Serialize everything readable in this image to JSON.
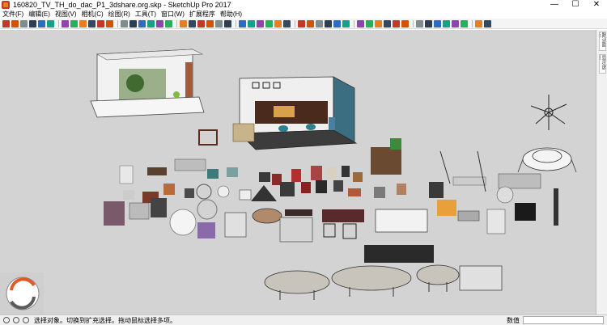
{
  "window": {
    "title": "160820_TV_TH_do_dac_P1_3dshare.org.skp - SketchUp Pro 2017",
    "minimize": "—",
    "maximize": "☐",
    "close": "✕"
  },
  "menubar": {
    "items": [
      {
        "label": "文件(F)"
      },
      {
        "label": "编辑(E)"
      },
      {
        "label": "视图(V)"
      },
      {
        "label": "相机(C)"
      },
      {
        "label": "绘图(R)"
      },
      {
        "label": "工具(T)"
      },
      {
        "label": "窗口(W)"
      },
      {
        "label": "扩展程序"
      },
      {
        "label": "帮助(H)"
      }
    ]
  },
  "toolbar": {
    "icons": [
      "select-icon",
      "eraser-icon",
      "paint-icon",
      "component-icon",
      "tape-icon",
      "section-icon",
      "xray-icon",
      "back-edges-icon",
      "wireframe-icon",
      "hidden-line-icon",
      "shaded-icon",
      "textured-icon",
      "monochrome-icon",
      "iso-icon",
      "top-icon",
      "front-icon",
      "right-icon",
      "back-icon",
      "left-icon",
      "orbit-icon",
      "pan-icon",
      "zoom-icon",
      "zoom-window-icon",
      "zoom-extents-icon",
      "previous-view-icon",
      "walk-icon",
      "look-around-icon",
      "position-camera-icon",
      "warehouse-icon",
      "extension-icon",
      "sandbox-icon",
      "follow-me-icon",
      "push-pull-icon",
      "move-icon",
      "rotate-icon",
      "scale-icon",
      "offset-icon",
      "line-icon",
      "arc-icon",
      "rectangle-icon",
      "circle-icon",
      "polygon-icon",
      "text-icon",
      "dimension-icon",
      "protractor-icon",
      "axes-icon",
      "3d-text-icon",
      "solid-union-icon",
      "solid-subtract-icon",
      "solid-trim-icon"
    ],
    "accent": "#2b6cc4"
  },
  "right_panel": {
    "tabs": [
      {
        "label": "默认面板"
      },
      {
        "label": "显示选项"
      }
    ]
  },
  "status": {
    "hint": "选择对象。切换到扩充选择。拖动鼠标选择多项。",
    "measure_label": "数值",
    "measure_value": ""
  },
  "scene": {
    "background": "#d3d3d3"
  }
}
